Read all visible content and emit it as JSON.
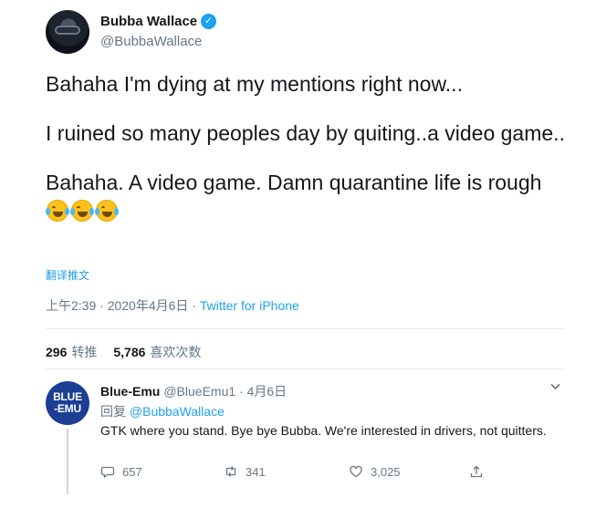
{
  "tweet": {
    "author_name": "Bubba Wallace",
    "author_handle": "@BubbaWallace",
    "verified_mark": "✓",
    "paragraphs": [
      "Bahaha I'm dying at my mentions right now...",
      "I ruined so many peoples day by quiting..a video game..",
      "Bahaha. A video game. Damn quarantine life is rough"
    ],
    "emojis": [
      "face-with-tears-of-joy",
      "face-with-tears-of-joy",
      "face-with-tears-of-joy"
    ],
    "translate_label": "翻译推文",
    "timestamp": "上午2:39 · 2020年4月6日 · ",
    "source": "Twitter for iPhone",
    "retweets_count": "296",
    "retweets_label": "转推",
    "likes_count": "5,786",
    "likes_label": "喜欢次数"
  },
  "reply": {
    "avatar_text_line1": "BLUE",
    "avatar_text_line2": "-EMU",
    "name": "Blue-Emu",
    "handle_date": "@BlueEmu1 · 4月6日",
    "reply_prefix": "回复 ",
    "reply_mention": "@BubbaWallace",
    "text": "GTK where you stand. Bye bye Bubba. We're interested in drivers, not quitters.",
    "replies": "657",
    "retweets": "341",
    "likes": "3,025"
  },
  "colors": {
    "accent": "#1da1f2",
    "secondary_text": "#657786",
    "primary_text": "#14171a",
    "divider": "#e6ecf0"
  }
}
